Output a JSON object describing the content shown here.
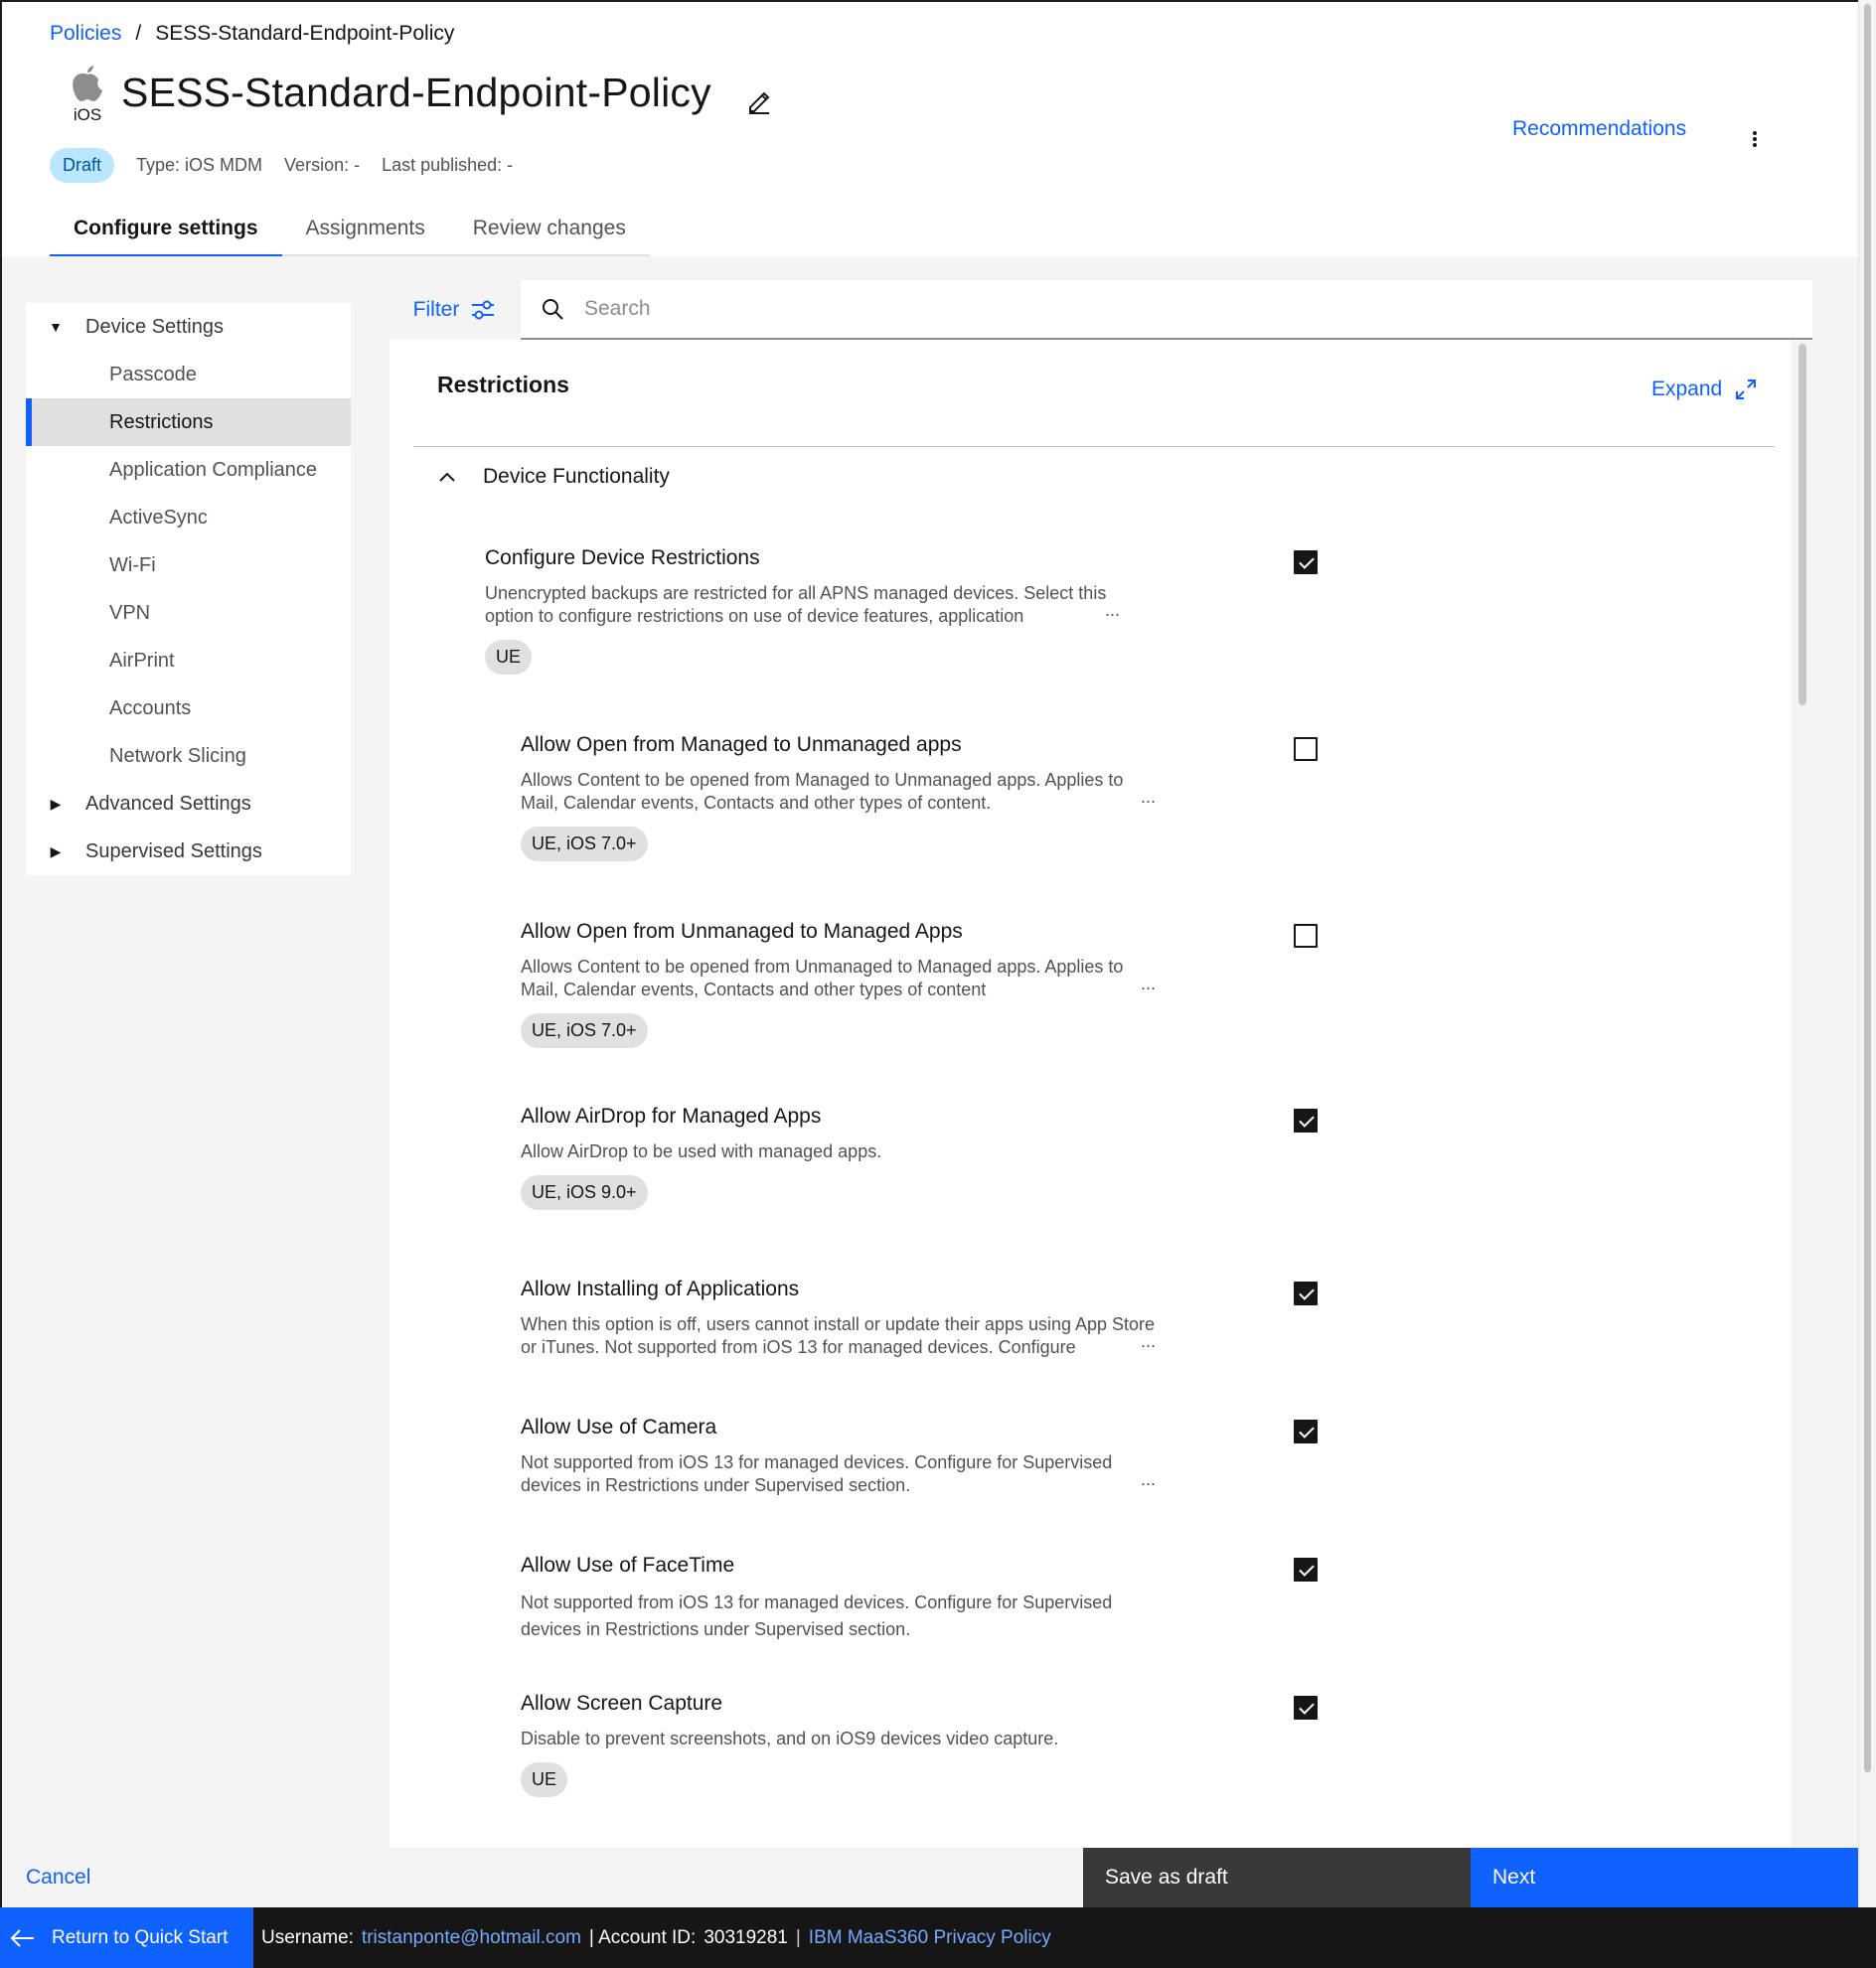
{
  "breadcrumb": {
    "root": "Policies",
    "separator": "/",
    "current": "SESS-Standard-Endpoint-Policy"
  },
  "header": {
    "os_label": "iOS",
    "title": "SESS-Standard-Endpoint-Policy",
    "status_badge": "Draft",
    "type": "Type: iOS MDM",
    "version": "Version: -",
    "last_published": "Last published: -",
    "recommendations": "Recommendations"
  },
  "tabs": [
    {
      "label": "Configure settings",
      "active": true
    },
    {
      "label": "Assignments",
      "active": false
    },
    {
      "label": "Review changes",
      "active": false
    }
  ],
  "sidebar": {
    "groups": [
      {
        "label": "Device Settings",
        "expanded": true
      },
      {
        "label": "Advanced Settings",
        "expanded": false
      },
      {
        "label": "Supervised Settings",
        "expanded": false
      }
    ],
    "items": [
      {
        "label": "Passcode",
        "selected": false
      },
      {
        "label": "Restrictions",
        "selected": true
      },
      {
        "label": "Application Compliance",
        "selected": false
      },
      {
        "label": "ActiveSync",
        "selected": false
      },
      {
        "label": "Wi-Fi",
        "selected": false
      },
      {
        "label": "VPN",
        "selected": false
      },
      {
        "label": "AirPrint",
        "selected": false
      },
      {
        "label": "Accounts",
        "selected": false
      },
      {
        "label": "Network Slicing",
        "selected": false
      }
    ]
  },
  "toolbar": {
    "filter_label": "Filter",
    "search_placeholder": "Search"
  },
  "panel": {
    "title": "Restrictions",
    "expand_label": "Expand",
    "section": "Device Functionality",
    "settings": [
      {
        "title": "Configure Device Restrictions",
        "description": "Unencrypted backups are restricted for all APNS managed devices. Select this option to configure restrictions on use of device features, application",
        "truncated": "...",
        "tag": "UE",
        "checked": true
      },
      {
        "title": "Allow Open from Managed to Unmanaged apps",
        "description": "Allows Content to be opened from Managed to Unmanaged apps. Applies to Mail, Calendar events, Contacts and other types of content.",
        "truncated": "...",
        "tag": "UE, iOS 7.0+",
        "checked": false
      },
      {
        "title": "Allow Open from Unmanaged to Managed Apps",
        "description": "Allows Content to be opened from Unmanaged to Managed apps. Applies to Mail, Calendar events, Contacts and other types of content",
        "truncated": "...",
        "tag": "UE, iOS 7.0+",
        "checked": false
      },
      {
        "title": "Allow AirDrop for Managed Apps",
        "description": "Allow AirDrop to be used with managed apps.",
        "truncated": "",
        "tag": "UE, iOS 9.0+",
        "checked": true
      },
      {
        "title": "Allow Installing of Applications",
        "description": "When this option is off, users cannot install or update their apps using App Store or iTunes. Not supported from iOS 13 for managed devices. Configure",
        "truncated": "...",
        "tag": "",
        "checked": true
      },
      {
        "title": "Allow Use of Camera",
        "description": "Not supported from iOS 13 for managed devices. Configure for Supervised devices in Restrictions under Supervised section.",
        "truncated": "...",
        "tag": "",
        "checked": true
      },
      {
        "title": "Allow Use of FaceTime",
        "description": "Not supported from iOS 13 for managed devices. Configure for Supervised devices in Restrictions under Supervised section.",
        "truncated": "",
        "tag": "",
        "checked": true
      },
      {
        "title": "Allow Screen Capture",
        "description": "Disable to prevent screenshots, and on iOS9 devices video capture.",
        "truncated": "",
        "tag": "UE",
        "checked": true
      }
    ]
  },
  "actions": {
    "cancel": "Cancel",
    "save_draft": "Save as draft",
    "next": "Next"
  },
  "footer": {
    "return_label": "Return to Quick Start",
    "username_label": "Username:",
    "username": "tristanponte@hotmail.com",
    "account_label": "| Account ID:",
    "account_id": "30319281",
    "pipe": "|",
    "privacy": "IBM MaaS360 Privacy Policy"
  },
  "colors": {
    "accent": "#0f62fe",
    "draft_badge_bg": "#bae6ff",
    "footer_bg": "#161616",
    "save_draft_bg": "#393939"
  }
}
